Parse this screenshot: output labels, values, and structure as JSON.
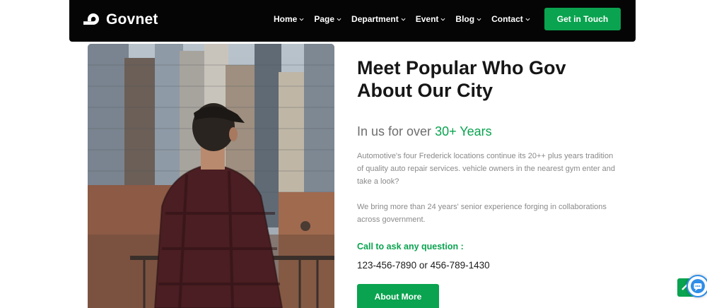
{
  "brand": {
    "name": "Govnet"
  },
  "nav": {
    "items": [
      {
        "label": "Home"
      },
      {
        "label": "Page"
      },
      {
        "label": "Department"
      },
      {
        "label": "Event"
      },
      {
        "label": "Blog"
      },
      {
        "label": "Contact"
      }
    ],
    "cta_label": "Get in Touch"
  },
  "about": {
    "title_line1": "Meet Popular Who Gov",
    "title_line2": "About Our City",
    "subtitle_prefix": "In us for over ",
    "subtitle_highlight": "30+ Years",
    "paragraph1": "Automotive's four Frederick locations continue its 20++ plus years tradition of quality auto repair services. vehicle owners in the nearest gym enter and take a look?",
    "paragraph2": "We bring more than 24 years' senior experience forging in collaborations across government.",
    "call_label": "Call to ask any question :",
    "phones": "123-456-7890 or 456-789-1430",
    "button_label": "About More"
  },
  "colors": {
    "accent": "#0aa34f",
    "header_bg": "#050505",
    "heading": "#161616",
    "body_text": "#8a8a8a"
  },
  "icons": {
    "logo": "govnet-logo-icon",
    "nav_chevron": "chevron-down-icon",
    "scroll_top": "arrow-up-icon",
    "chat": "chat-support-icon"
  }
}
